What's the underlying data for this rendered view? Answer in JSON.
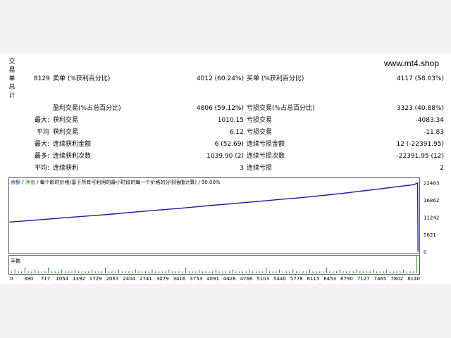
{
  "report": {
    "side_title": "交易单总计",
    "site": "www.mt4.shop"
  },
  "stats": {
    "total": "8129",
    "short_label": "卖单 (%获利百分比)",
    "short_value": "4012 (60.24%)",
    "long_label": "买单 (%获利百分比)",
    "long_value": "4117 (58.03%)",
    "profit_trades_label": "盈利交易(%占总百分比)",
    "profit_trades_value": "4806 (59.12%)",
    "loss_trades_label": "亏损交易(%占总百分比)",
    "loss_trades_value": "3323 (40.88%)",
    "max_label": "最大:",
    "largest_profit_label": "获利交易",
    "largest_profit_value": "1010.15",
    "largest_loss_label": "亏损交易",
    "largest_loss_value": "-4083.34",
    "avg_label": "平均",
    "avg_profit_label": "获利交易",
    "avg_profit_value": "6.12",
    "avg_loss_label": "亏损交易",
    "avg_loss_value": "-11.83",
    "max2_label": "最大:",
    "max_cons_wins_label": "连续获利金额",
    "max_cons_wins_value": "6 (52.69)",
    "max_cons_losses_label": "连续亏损金额",
    "max_cons_losses_value": "12 (-22391.95)",
    "most_label": "最多:",
    "max_cons_profit_label": "连续获利次数",
    "max_cons_profit_value": "1039.90 (2)",
    "max_cons_loss_label": "连续亏损次数",
    "max_cons_loss_value": "-22391.95 (12)",
    "avg2_label": "平均:",
    "avg_cons_wins_label": "连续获利",
    "avg_cons_wins_value": "3",
    "avg_cons_losses_label": "连续亏损",
    "avg_cons_losses_value": "2"
  },
  "chart_legend": {
    "balance": "余额",
    "sep1": " / ",
    "equity": "净值",
    "rest": " / 每个即时价格(基于所有可利用的最小时段的每一个价格的分形插值计算) / 90.00%"
  },
  "volume_label": "手数",
  "colors": {
    "balance_line": "#1a1aa6",
    "equity_line": "#1a8a1a",
    "axis": "#555555"
  },
  "chart_data": {
    "type": "line",
    "title": "",
    "x_ticks": [
      "0",
      "380",
      "717",
      "1054",
      "1392",
      "1729",
      "2067",
      "2404",
      "2741",
      "3079",
      "3416",
      "3753",
      "4091",
      "4428",
      "4766",
      "5103",
      "5440",
      "5778",
      "6115",
      "6453",
      "6790",
      "7127",
      "7465",
      "7802",
      "8140"
    ],
    "y_ticks": [
      "22483",
      "16862",
      "11242",
      "5621",
      "0"
    ],
    "xlim": [
      0,
      8240
    ],
    "ylim": [
      0,
      22483
    ],
    "series": [
      {
        "name": "余额",
        "x": [
          0,
          380,
          717,
          1054,
          1392,
          1729,
          2067,
          2404,
          2741,
          3079,
          3416,
          3753,
          4091,
          4428,
          4766,
          5103,
          5440,
          5778,
          6115,
          6453,
          6790,
          7127,
          7465,
          7802,
          8140,
          8220,
          8229
        ],
        "y": [
          9800,
          10250,
          10700,
          11150,
          11550,
          11950,
          12400,
          12900,
          13350,
          13800,
          14250,
          14750,
          15250,
          15700,
          16200,
          16650,
          17150,
          17600,
          18150,
          18700,
          19300,
          19950,
          20600,
          21300,
          21950,
          22483,
          300
        ]
      }
    ],
    "volume": [
      1,
      2,
      1,
      1,
      3,
      1,
      1,
      2,
      1,
      1,
      1,
      3,
      1,
      1,
      1,
      2,
      1,
      1,
      1,
      2,
      1,
      1,
      1,
      1,
      2,
      1,
      1,
      1,
      3,
      1,
      1,
      1,
      2,
      1,
      1,
      1,
      1,
      2,
      1,
      1,
      1,
      1,
      2,
      1,
      1,
      1,
      1,
      2,
      1,
      1,
      1,
      1,
      3,
      1,
      1,
      1,
      2,
      1,
      1,
      1,
      1,
      2,
      1,
      1,
      1,
      1,
      2,
      1,
      1,
      1,
      1,
      2,
      1,
      1,
      1,
      1,
      3,
      1,
      1,
      1,
      2,
      1,
      1,
      1,
      2,
      1,
      1,
      1,
      1,
      2,
      1,
      1,
      1,
      1,
      3,
      1,
      1,
      1,
      2,
      1,
      1,
      1,
      1,
      2,
      1,
      1,
      1,
      1,
      2,
      1,
      1,
      1,
      2,
      1,
      1,
      1,
      1,
      2,
      1,
      1,
      1,
      9
    ]
  }
}
